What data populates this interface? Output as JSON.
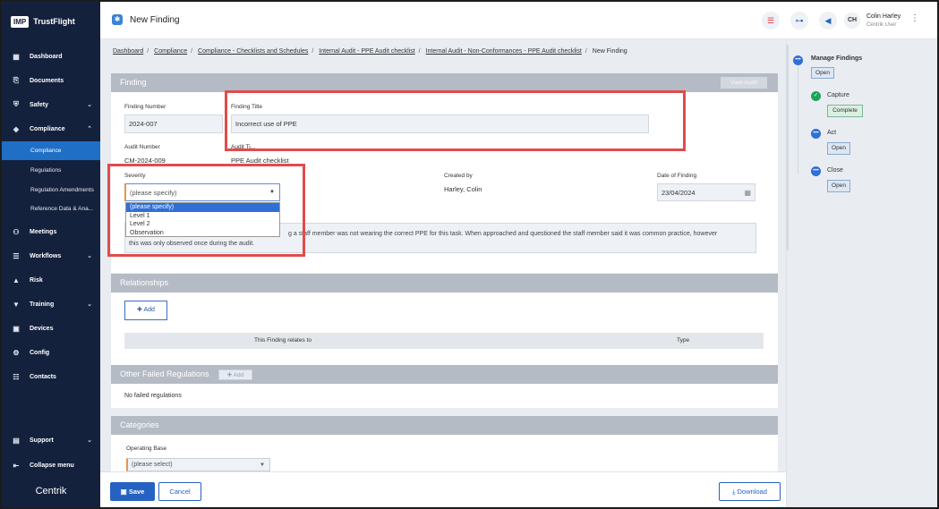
{
  "app": {
    "badge": "IMP",
    "name": "TrustFlight",
    "footer_logo": "Centrik"
  },
  "sidebar": {
    "items": [
      {
        "label": "Dashboard",
        "icon": "dashboard-icon",
        "glyph": "▦"
      },
      {
        "label": "Documents",
        "icon": "paperclip-icon",
        "glyph": "⎘"
      },
      {
        "label": "Safety",
        "icon": "shield-icon",
        "glyph": "⛨"
      },
      {
        "label": "Compliance",
        "icon": "check-shield-icon",
        "glyph": "◈"
      },
      {
        "label": "Meetings",
        "icon": "meetings-icon",
        "glyph": "⚇"
      },
      {
        "label": "Workflows",
        "icon": "workflow-icon",
        "glyph": "☰"
      },
      {
        "label": "Risk",
        "icon": "warning-icon",
        "glyph": "▲"
      },
      {
        "label": "Training",
        "icon": "graduation-cap-icon",
        "glyph": "▼"
      },
      {
        "label": "Devices",
        "icon": "devices-icon",
        "glyph": "▣"
      },
      {
        "label": "Config",
        "icon": "config-icon",
        "glyph": "⚙"
      },
      {
        "label": "Contacts",
        "icon": "contacts-icon",
        "glyph": "☷"
      }
    ],
    "compliance_sub": [
      "Compliance",
      "Regulations",
      "Regulation Amendments",
      "Reference Data & Ana..."
    ],
    "support_label": "Support",
    "collapse_label": "Collapse menu"
  },
  "header": {
    "title": "New Finding",
    "user_initials": "CH",
    "user_name": "Colin Harley",
    "user_role": "Centrik User"
  },
  "breadcrumb": [
    "Dashboard",
    "Compliance",
    "Compliance - Checklists and Schedules",
    "Internal Audit - PPE Audit checklist",
    "Internal Audit - Non-Conformances - PPE Audit checklist"
  ],
  "breadcrumb_current": "New Finding",
  "finding": {
    "section_title": "Finding",
    "view_audit_label": "View Audit",
    "number_label": "Finding Number",
    "number_value": "2024-007",
    "title_label": "Finding Title",
    "title_value": "Incorrect use of PPE",
    "audit_number_label": "Audit Number",
    "audit_number_value": "CM-2024-009",
    "audit_title_label": "Audit Ti...",
    "audit_title_value": "PPE Audit checklist",
    "severity_label": "Severity",
    "severity_value": "(please specify)",
    "severity_options": [
      "(please specify)",
      "Level 1",
      "Level 2",
      "Observation"
    ],
    "created_by_label": "Created by",
    "created_by_value": "Harley, Colin",
    "date_label": "Date of Finding",
    "date_value": "23/04/2024",
    "description_line1": "g a staff member was not wearing the correct PPE for this task. When approached and questioned the staff member said it was common practice, however",
    "description_line2": "this was only observed once during the audit."
  },
  "relationships": {
    "section_title": "Relationships",
    "add_label": "Add",
    "col_relates": "This Finding relates to",
    "col_type": "Type"
  },
  "failed_regs": {
    "section_title": "Other Failed Regulations",
    "add_label": "Add",
    "empty_text": "No failed regulations"
  },
  "categories": {
    "section_title": "Categories",
    "operating_base_label": "Operating Base",
    "operating_base_value": "(please select)"
  },
  "footer": {
    "save_label": "Save",
    "cancel_label": "Cancel",
    "download_label": "Download"
  },
  "workflow": {
    "title": "Manage Findings",
    "title_status": "Open",
    "steps": [
      {
        "label": "Capture",
        "status": "Complete",
        "state": "done"
      },
      {
        "label": "Act",
        "status": "Open",
        "state": "pending"
      },
      {
        "label": "Close",
        "status": "Open",
        "state": "pending"
      }
    ]
  },
  "colors": {
    "sidebar_bg": "#14213d",
    "accent": "#2562c2",
    "highlight_box": "#e14b4b",
    "complete": "#1fa35a"
  }
}
